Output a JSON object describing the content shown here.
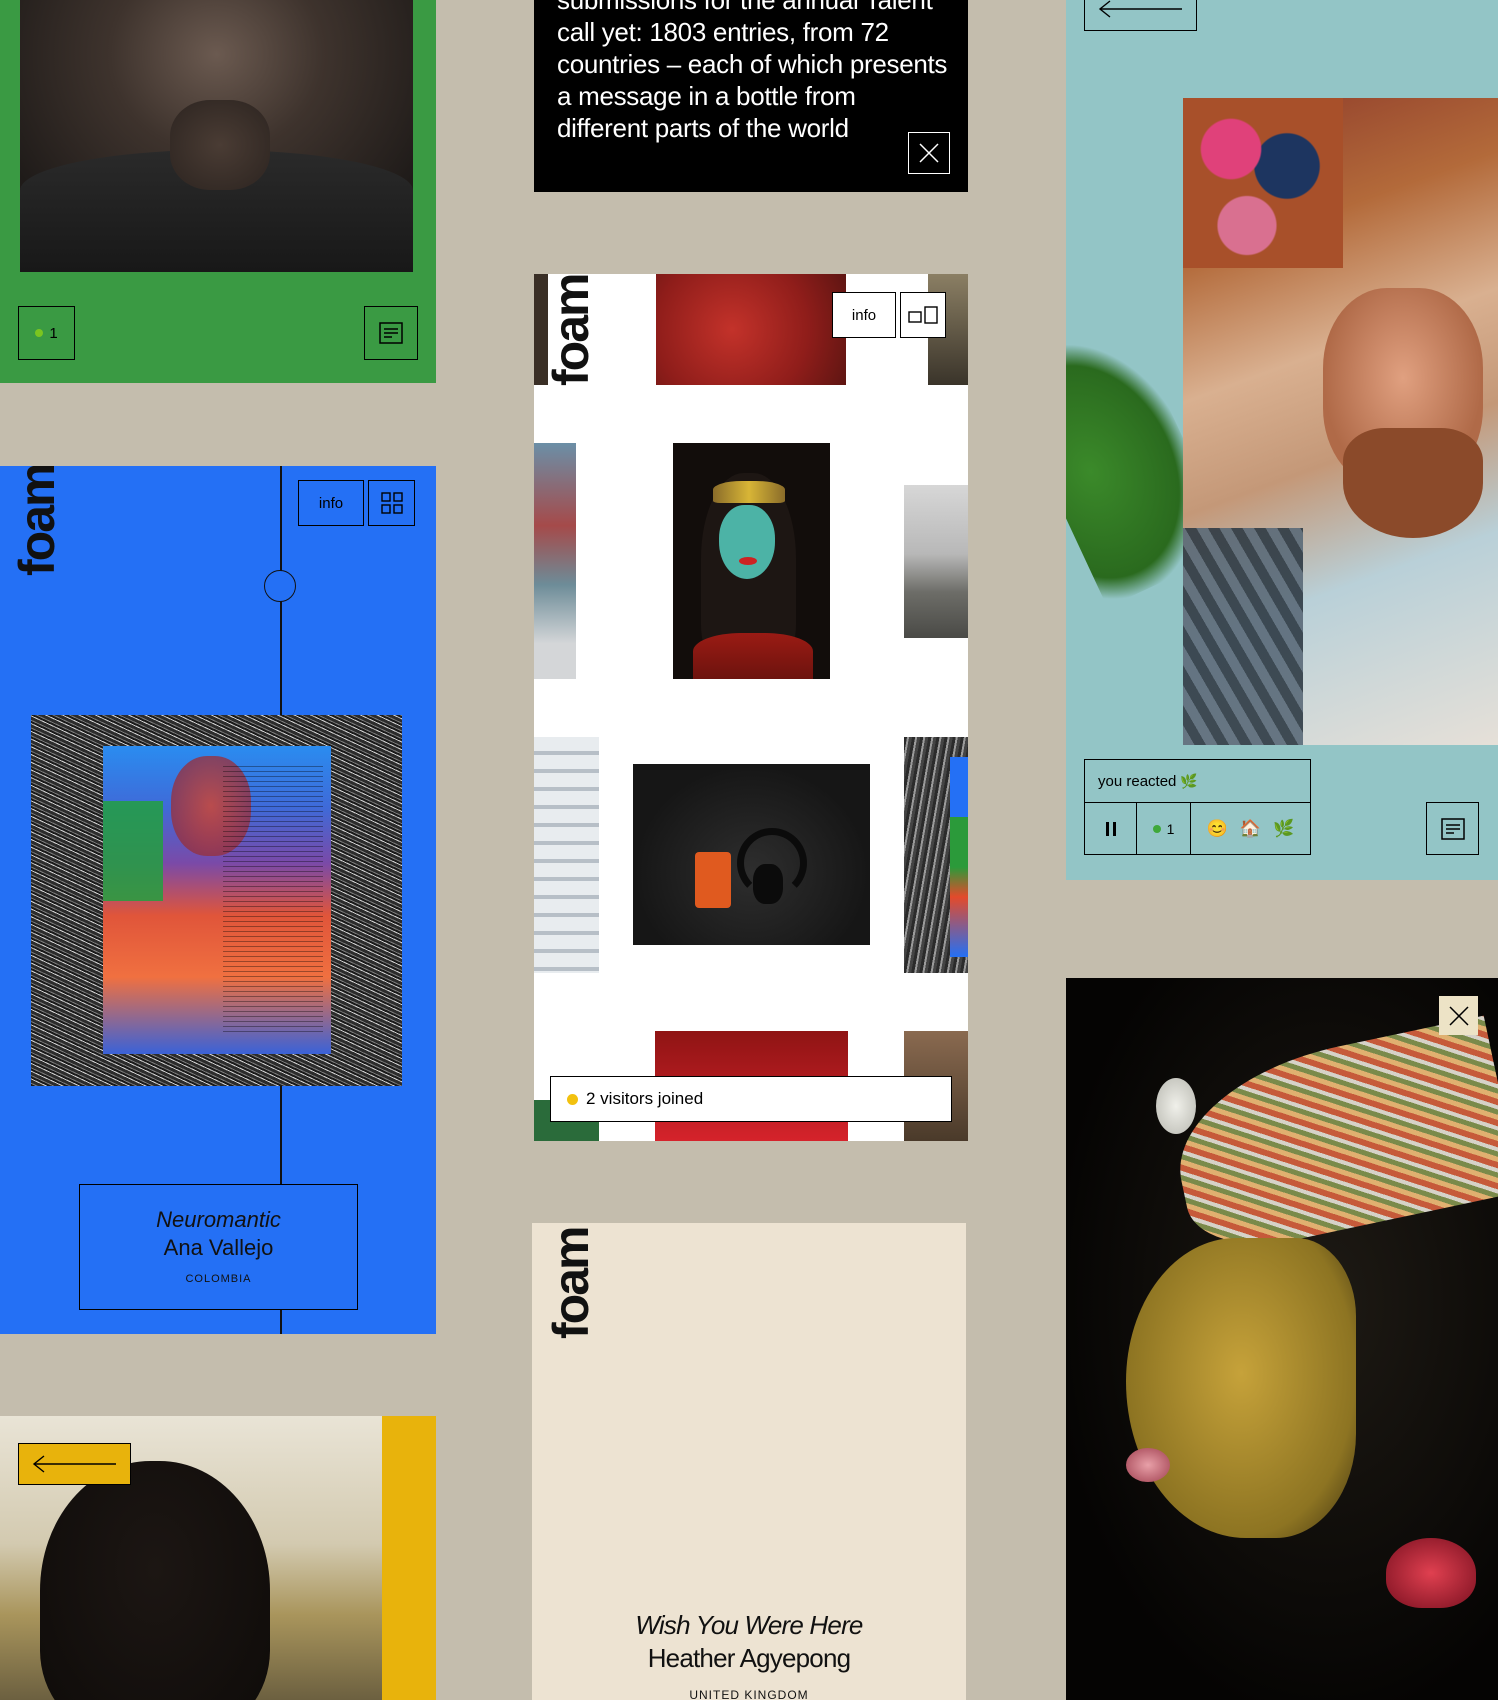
{
  "green_panel": {
    "count": "1",
    "colors": {
      "bg": "#3a9a43",
      "dot": "#7bc520"
    }
  },
  "black_banner": {
    "text": "submissions for the annual Talent call yet: 1803 entries, from 72 countries – each of which presents a message in a bottle from different parts of the world"
  },
  "gallery_panel": {
    "logo": "foam",
    "info_label": "info",
    "toast_text": "2 visitors joined"
  },
  "blue_panel": {
    "logo": "foam",
    "info_label": "info",
    "title": "Neuromantic",
    "artist": "Ana Vallejo",
    "country": "COLOMBIA",
    "colors": {
      "bg": "#2470f5"
    }
  },
  "yellow_panel": {
    "colors": {
      "accent": "#e8b30c"
    }
  },
  "cream_panel": {
    "logo": "foam",
    "title": "Wish You Were Here",
    "artist": "Heather Agyepong",
    "country": "UNITED KINGDOM",
    "colors": {
      "bg": "#ede3d2"
    }
  },
  "teal_panel": {
    "reaction_text": "you reacted",
    "reaction_emoji": "🌿",
    "count": "1",
    "emojis": [
      "😊",
      "🏠",
      "🌿"
    ],
    "colors": {
      "bg": "#93c5c6"
    }
  },
  "portrait_panel": {
    "colors": {
      "close_bg": "#ede3c6"
    }
  }
}
